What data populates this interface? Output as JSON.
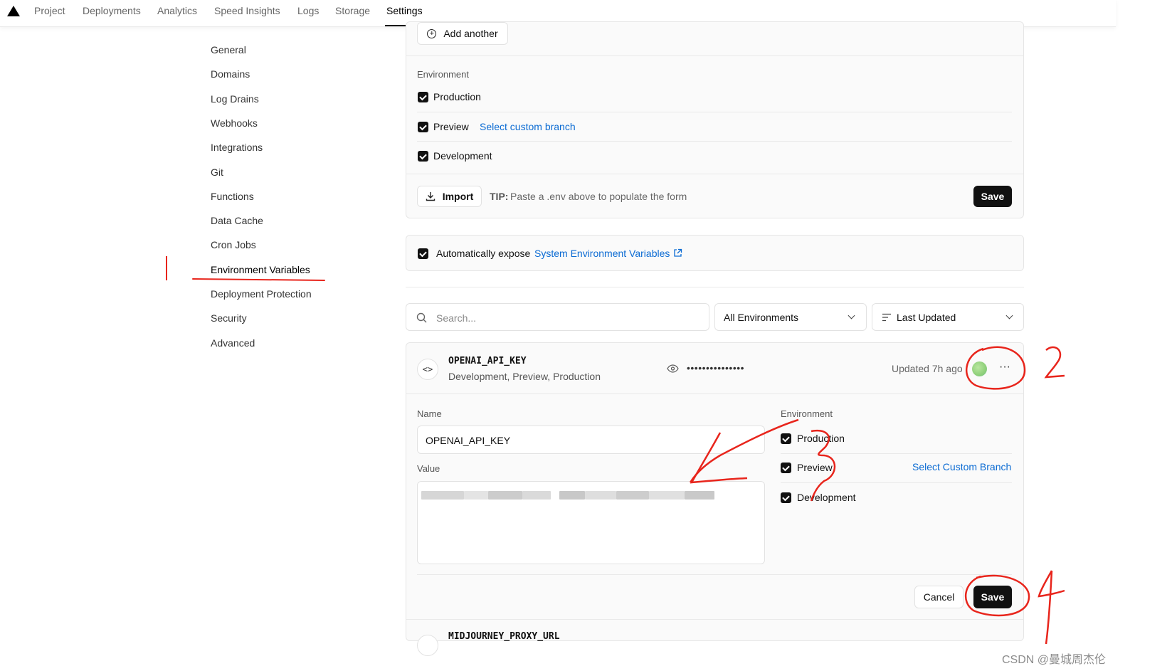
{
  "nav": {
    "tabs": [
      "Project",
      "Deployments",
      "Analytics",
      "Speed Insights",
      "Logs",
      "Storage",
      "Settings"
    ],
    "active": "Settings"
  },
  "sidebar": {
    "items": [
      "General",
      "Domains",
      "Log Drains",
      "Webhooks",
      "Integrations",
      "Git",
      "Functions",
      "Data Cache",
      "Cron Jobs",
      "Environment Variables",
      "Deployment Protection",
      "Security",
      "Advanced"
    ],
    "active": "Environment Variables"
  },
  "add_form": {
    "add_another": "Add another",
    "environment_label": "Environment",
    "environments": [
      "Production",
      "Preview",
      "Development"
    ],
    "select_custom_branch": "Select custom branch",
    "import": "Import",
    "tip_prefix": "TIP:",
    "tip_text": "Paste a .env above to populate the form",
    "save": "Save"
  },
  "expose": {
    "text": "Automatically expose",
    "link": "System Environment Variables"
  },
  "filters": {
    "search_placeholder": "Search...",
    "environment_filter": "All Environments",
    "sort": "Last Updated"
  },
  "variable": {
    "key": "OPENAI_API_KEY",
    "environments": "Development, Preview, Production",
    "masked_value": "•••••••••••••••",
    "updated": "Updated 7h ago",
    "more": "···"
  },
  "edit_form": {
    "name_label": "Name",
    "name_value": "OPENAI_API_KEY",
    "value_label": "Value",
    "environment_label": "Environment",
    "environments": [
      "Production",
      "Preview",
      "Development"
    ],
    "select_custom_branch": "Select Custom Branch",
    "cancel": "Cancel",
    "save": "Save"
  },
  "next_variable": {
    "key": "MIDJOURNEY_PROXY_URL"
  },
  "annotations": [
    "2",
    "3",
    "4"
  ],
  "watermark": "CSDN @曼城周杰伦",
  "colors": {
    "accent": "#0b6bd3",
    "annotation": "#e8251c",
    "avatar": "#8fd07a"
  }
}
